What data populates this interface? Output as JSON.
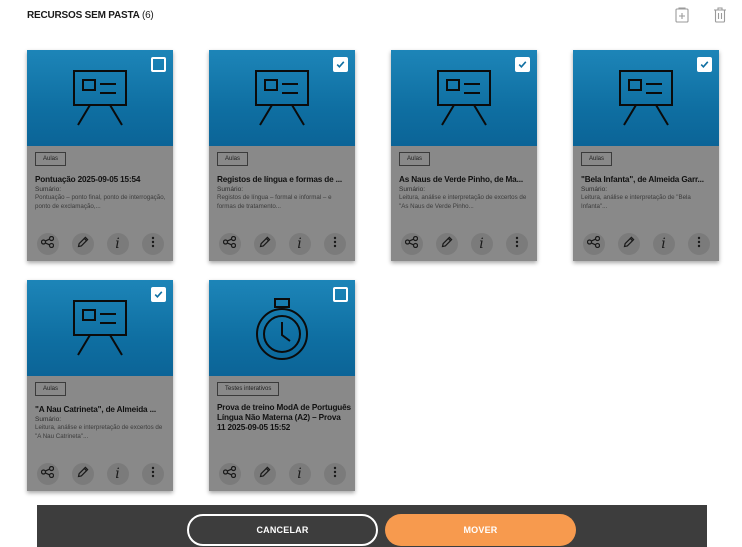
{
  "header": {
    "title": "RECURSOS SEM PASTA",
    "count": "(6)"
  },
  "header_icons": [
    "add-folder-icon",
    "trash-icon"
  ],
  "summary_label": "Sumário:",
  "cards": [
    {
      "thumb_icon": "presentation-board-icon",
      "checked": false,
      "tag": "Aulas",
      "title": "Pontuação 2025-09-05 15:54",
      "summary": "Pontuação – ponto final, ponto de interrogação, ponto de exclamação,..."
    },
    {
      "thumb_icon": "presentation-board-icon",
      "checked": true,
      "tag": "Aulas",
      "title": "Registos de língua e formas de ...",
      "summary": "Registos de língua – formal e informal – e formas de tratamento..."
    },
    {
      "thumb_icon": "presentation-board-icon",
      "checked": true,
      "tag": "Aulas",
      "title": "As Naus de Verde Pinho, de Ma...",
      "summary": "Leitura, análise e interpretação de excertos de \"As Naus de Verde Pinho..."
    },
    {
      "thumb_icon": "presentation-board-icon",
      "checked": true,
      "tag": "Aulas",
      "title": "\"Bela Infanta\", de Almeida Garr...",
      "summary": "Leitura, análise e interpretação de \"Bela Infanta\"..."
    },
    {
      "thumb_icon": "presentation-board-icon",
      "checked": true,
      "tag": "Aulas",
      "title": "\"A Nau Catrineta\", de Almeida ...",
      "summary": "Leitura, análise e interpretação de excertos de \"A Nau Catrineta\"..."
    },
    {
      "thumb_icon": "stopwatch-icon",
      "checked": false,
      "tag": "Testes interativos",
      "title": "Prova de treino ModA de Português Língua Não Materna (A2) – Prova 11 2025-09-05 15:52",
      "summary": ""
    }
  ],
  "card_actions": [
    "share-icon",
    "edit-pencil-icon",
    "info-icon",
    "more-vertical-icon"
  ],
  "footer": {
    "cancel_label": "CANCELAR",
    "move_label": "MOVER"
  },
  "colors": {
    "thumb_blue": "#0f6fa2",
    "card_gray": "#898989",
    "footer_dark": "#3d3d3d",
    "move_orange": "#f79a4e"
  }
}
